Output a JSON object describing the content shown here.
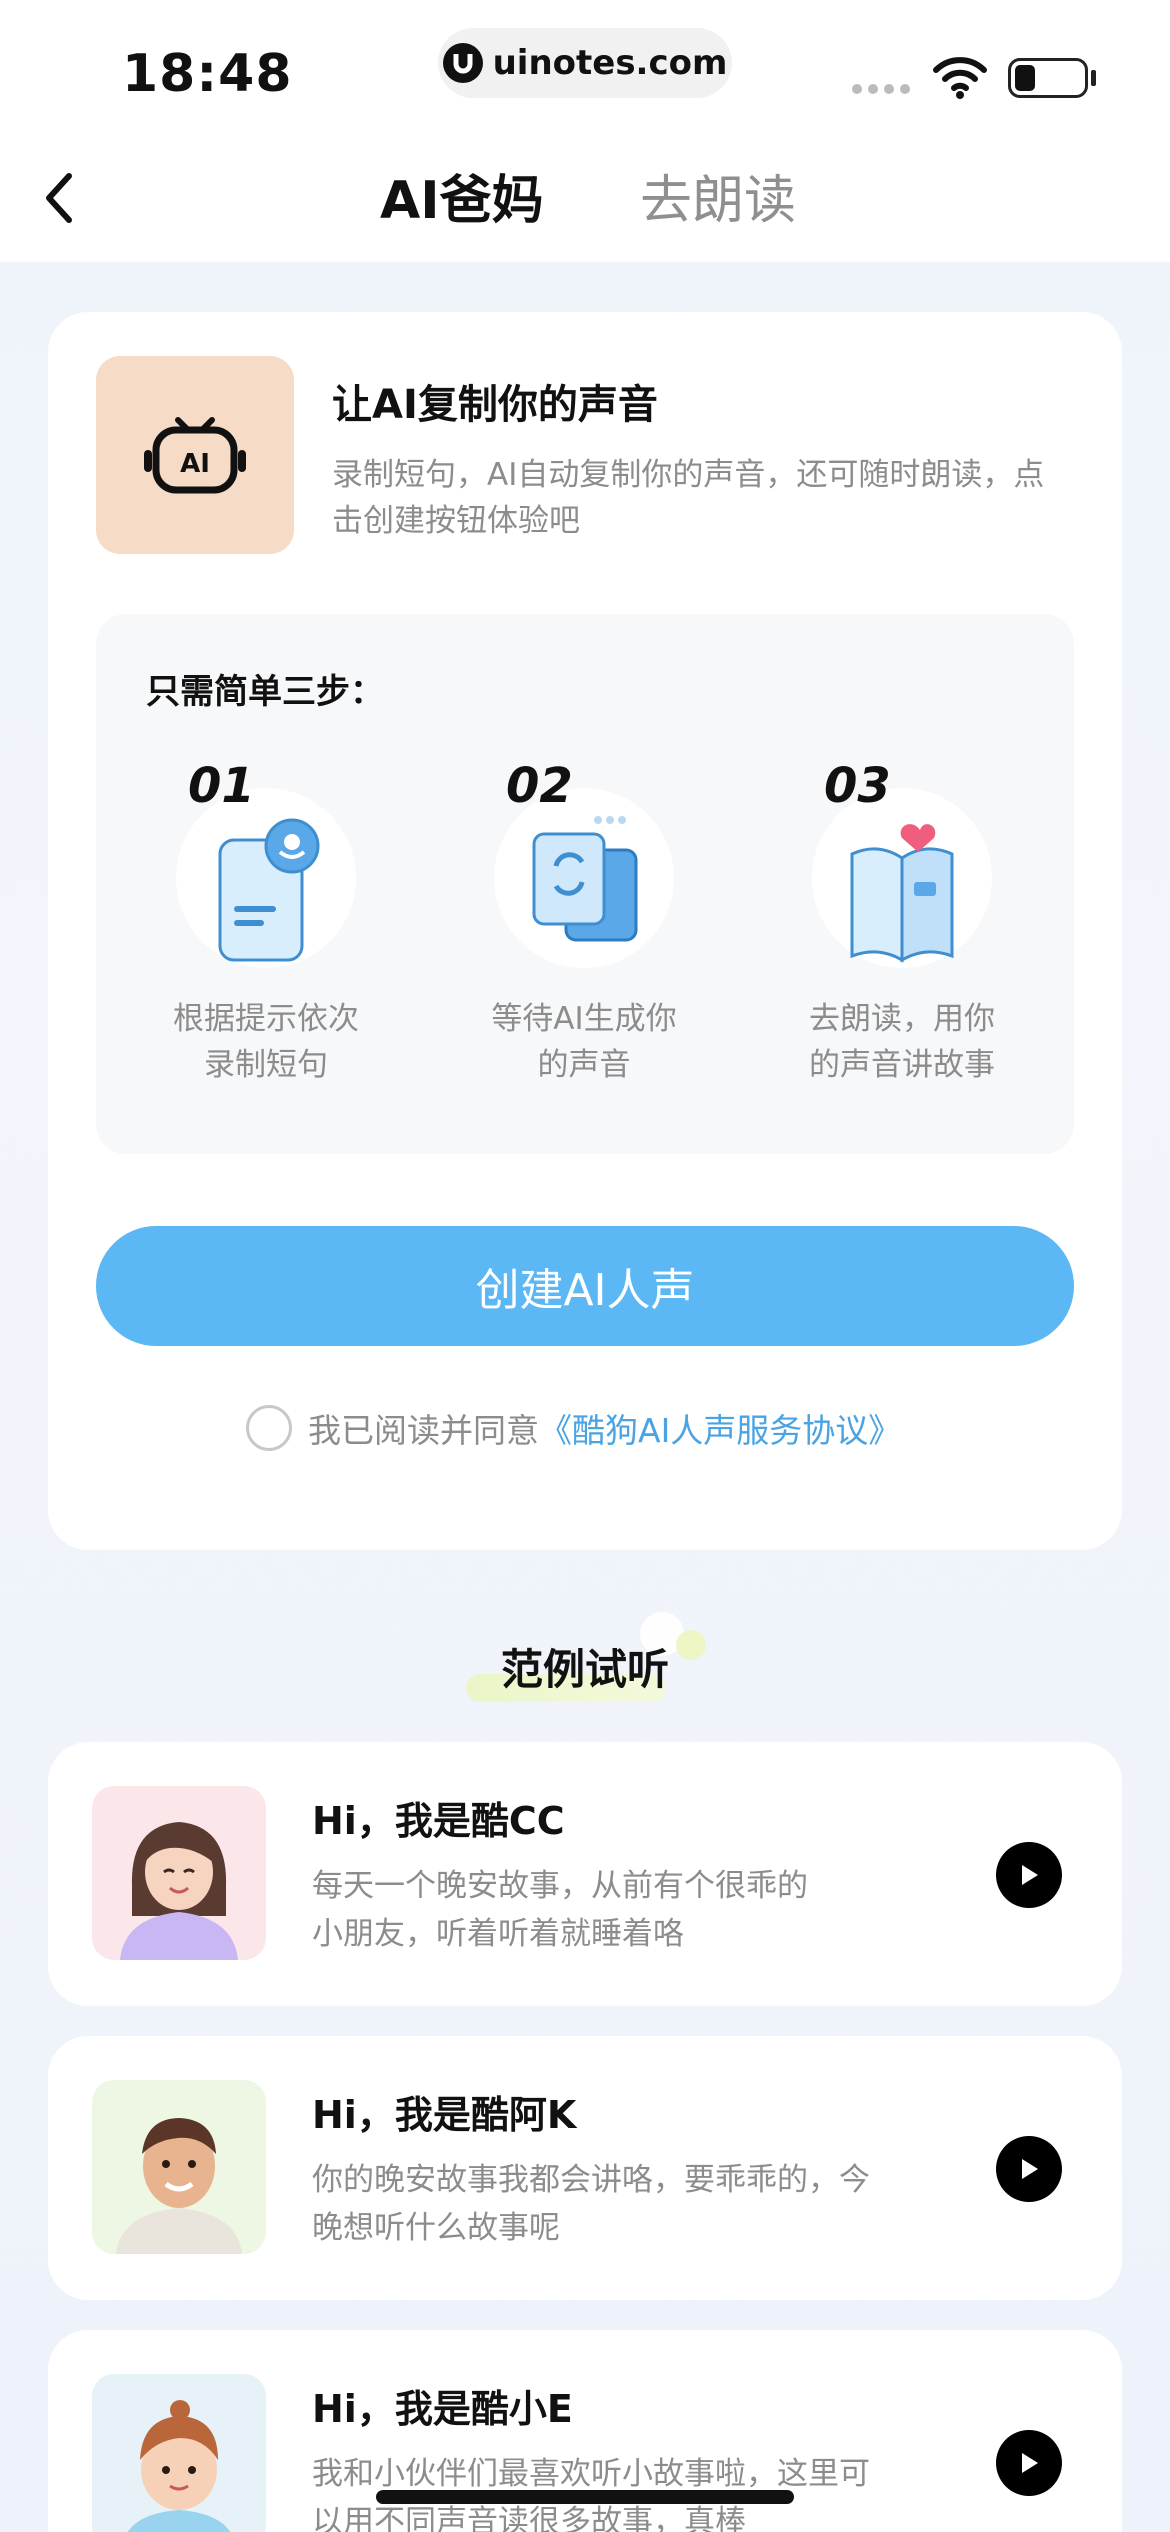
{
  "status_bar": {
    "time": "18:48",
    "url": "uinotes.com"
  },
  "nav": {
    "tabs": [
      {
        "label": "AI爸妈",
        "active": true
      },
      {
        "label": "去朗读",
        "active": false
      }
    ]
  },
  "intro": {
    "title": "让AI复制你的声音",
    "description": "录制短句，AI自动复制你的声音，还可随时朗读，点击创建按钮体验吧"
  },
  "steps": {
    "title": "只需简单三步：",
    "items": [
      {
        "number": "01",
        "line1": "根据提示依次",
        "line2": "录制短句",
        "icon": "phone-mic-icon"
      },
      {
        "number": "02",
        "line1": "等待AI生成你",
        "line2": "的声音",
        "icon": "sync-cards-icon"
      },
      {
        "number": "03",
        "line1": "去朗读，用你",
        "line2": "的声音讲故事",
        "icon": "book-heart-icon"
      }
    ]
  },
  "create_button": {
    "label": "创建AI人声"
  },
  "agreement": {
    "text": "我已阅读并同意",
    "link": "《酷狗AI人声服务协议》"
  },
  "samples": {
    "title": "范例试听",
    "items": [
      {
        "hi": "Hi，",
        "name": "我是酷CC",
        "desc1": "每天一个晚安故事，从前有个很乖的",
        "desc2": "小朋友，听着听着就睡着咯"
      },
      {
        "hi": "Hi，",
        "name": "我是酷阿K",
        "desc1": "你的晚安故事我都会讲咯，要乖乖的，今",
        "desc2": "晚想听什么故事呢"
      },
      {
        "hi": "Hi，",
        "name": "我是酷小E",
        "desc1": "我和小伙伴们最喜欢听小故事啦，这里可",
        "desc2": "以用不同声音读很多故事，真棒"
      }
    ]
  },
  "colors": {
    "accent": "#5cb8f4",
    "link": "#4aa3e3",
    "robot_tile": "#f6dcc6"
  }
}
